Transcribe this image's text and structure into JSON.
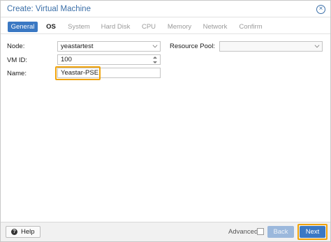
{
  "dialog": {
    "title": "Create: Virtual Machine",
    "close_icon": "close-circle-icon"
  },
  "tabs": [
    {
      "label": "General",
      "state": "active"
    },
    {
      "label": "OS",
      "state": "enabled"
    },
    {
      "label": "System",
      "state": "disabled"
    },
    {
      "label": "Hard Disk",
      "state": "disabled"
    },
    {
      "label": "CPU",
      "state": "disabled"
    },
    {
      "label": "Memory",
      "state": "disabled"
    },
    {
      "label": "Network",
      "state": "disabled"
    },
    {
      "label": "Confirm",
      "state": "disabled"
    }
  ],
  "form": {
    "node_label": "Node:",
    "node_value": "yeastartest",
    "vmid_label": "VM ID:",
    "vmid_value": "100",
    "name_label": "Name:",
    "name_value": "Yeastar-PSE",
    "pool_label": "Resource Pool:",
    "pool_value": ""
  },
  "footer": {
    "help_label": "Help",
    "advanced_label": "Advanced",
    "advanced_checked": false,
    "back_label": "Back",
    "next_label": "Next"
  },
  "colors": {
    "accent": "#3a78c3",
    "highlight": "#f0a30a",
    "title": "#3b6fa8"
  }
}
